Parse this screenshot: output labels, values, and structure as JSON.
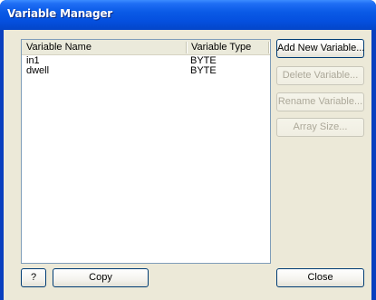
{
  "window": {
    "title": "Variable Manager"
  },
  "list": {
    "columns": [
      "Variable Name",
      "Variable Type"
    ],
    "rows": [
      {
        "name": "in1",
        "type": "BYTE"
      },
      {
        "name": "dwell",
        "type": "BYTE"
      }
    ]
  },
  "buttons": {
    "add": "Add New Variable...",
    "delete": "Delete Variable...",
    "rename": "Rename Variable...",
    "array_size": "Array Size...",
    "help": "?",
    "copy": "Copy",
    "close": "Close"
  },
  "colors": {
    "titlebar": "#0550df",
    "face": "#ece9d8",
    "button_border": "#003c74",
    "disabled_text": "#aca899"
  }
}
